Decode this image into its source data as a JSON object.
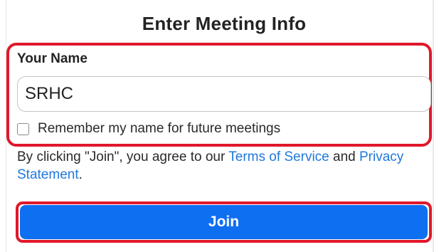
{
  "dialog": {
    "title": "Enter Meeting Info"
  },
  "name_field": {
    "label": "Your Name",
    "value": "SRHC"
  },
  "remember_checkbox": {
    "label": "Remember my name for future meetings",
    "checked": false
  },
  "terms": {
    "prefix": "By clicking \"Join\", you agree to our ",
    "terms_link": "Terms of Service",
    "middle": " and ",
    "privacy_link": "Privacy Statement",
    "suffix": "."
  },
  "join_button": {
    "label": "Join"
  },
  "colors": {
    "primary_button": "#0e6ff0",
    "link": "#1e78dc",
    "highlight_outline": "#e0182b"
  }
}
